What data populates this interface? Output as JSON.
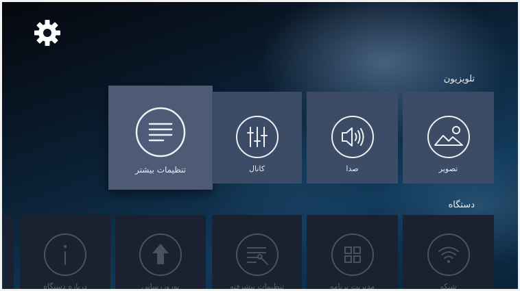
{
  "sections": {
    "tv": "تلویزیون",
    "device": "دستگاه"
  },
  "tv_tiles": [
    {
      "label": "تنظیمات بیشتر",
      "icon": "menu-lines-icon"
    },
    {
      "label": "کانال",
      "icon": "equalizer-icon"
    },
    {
      "label": "صدا",
      "icon": "speaker-icon"
    },
    {
      "label": "تصویر",
      "icon": "picture-icon"
    }
  ],
  "device_tiles": [
    {
      "label": "درباره دستگاه",
      "icon": "info-icon"
    },
    {
      "label": "به‌روزرسانی",
      "icon": "upload-arrow-icon"
    },
    {
      "label": "تنظیمات پیشرفته",
      "icon": "settings-tools-icon"
    },
    {
      "label": "مدیریت برنامه",
      "icon": "apps-grid-icon"
    },
    {
      "label": "شبکه",
      "icon": "wifi-icon"
    }
  ],
  "colors": {
    "tile": "#3d4c66",
    "tile_focus": "#4d5b77",
    "tile_dim": "#1a2231"
  }
}
